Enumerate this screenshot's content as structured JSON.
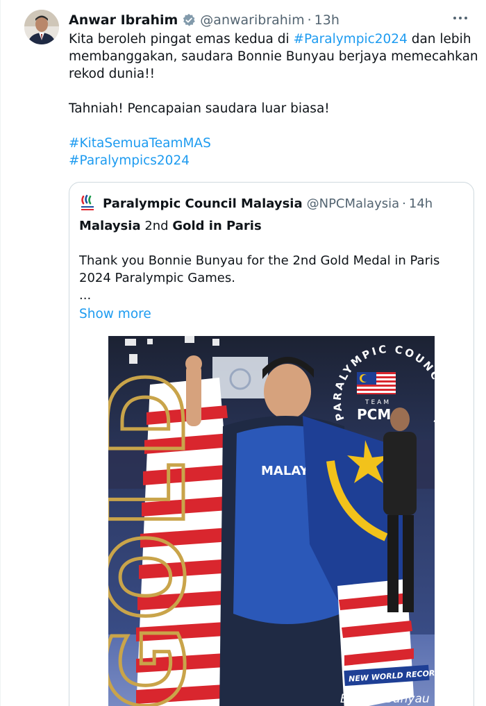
{
  "author": {
    "name": "Anwar Ibrahim",
    "handle": "@anwaribrahim",
    "separator": "·",
    "time": "13h"
  },
  "tweet": {
    "line1_pre": "Kita beroleh pingat emas kedua di ",
    "line1_tag": "#Paralympic2024",
    "line1_post": " dan lebih",
    "line2": "membanggakan, saudara Bonnie Bunyau berjaya memecahkan",
    "line3": "rekod dunia!!",
    "line4": "Tahniah! Pencapaian saudara luar biasa!",
    "hashtag1": "#KitaSemuaTeamMAS",
    "hashtag2": "#Paralympics2024"
  },
  "quote": {
    "name": "Paralympic Council Malaysia",
    "handle": "@NPCMalaysia",
    "separator": "·",
    "time": "14h",
    "title_part1": "Malaysia",
    "title_part2": " 2nd ",
    "title_part3": "Gold in Paris",
    "text_line1": "Thank you Bonnie Bunyau for the 2nd Gold Medal in Paris",
    "text_line2": "2024 Paralympic Games.",
    "ellipsis": "...",
    "show_more": "Show more"
  },
  "photo": {
    "big_word": "GOLD",
    "arc_text": "PARALYMPIC COUNCIL MALAYSIA",
    "team_label": "TEAM",
    "team_name": "PCM",
    "jersey_text": "MALAY",
    "banner_text": "NEW WORLD RECORD",
    "athlete_name": "Bonnie Bunyau"
  },
  "colors": {
    "link": "#1d9bf0",
    "secondary_text": "#536471",
    "verified_badge": "#829aab",
    "gold": "#c9a44a"
  },
  "icons": {
    "verified": "verified-badge-icon",
    "more": "more-options-icon",
    "quote_avatar": "paralympic-logo-icon"
  }
}
